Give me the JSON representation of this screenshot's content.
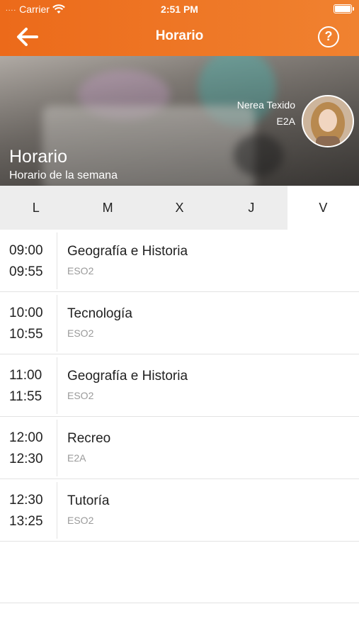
{
  "status_bar": {
    "signal": "....",
    "carrier": "Carrier",
    "time": "2:51 PM"
  },
  "nav": {
    "title": "Horario",
    "back_icon": "arrow-left-icon",
    "help_icon": "question-circle-icon",
    "help_glyph": "?"
  },
  "hero": {
    "title": "Horario",
    "subtitle": "Horario de la semana",
    "user_name": "Nerea Texido",
    "user_group": "E2A"
  },
  "days": {
    "items": [
      "L",
      "M",
      "X",
      "J",
      "V"
    ],
    "selected": "V"
  },
  "schedule": [
    {
      "start": "09:00",
      "end": "09:55",
      "subject": "Geografía e Historia",
      "group": "ESO2"
    },
    {
      "start": "10:00",
      "end": "10:55",
      "subject": "Tecnología",
      "group": "ESO2"
    },
    {
      "start": "11:00",
      "end": "11:55",
      "subject": "Geografía e Historia",
      "group": "ESO2"
    },
    {
      "start": "12:00",
      "end": "12:30",
      "subject": "Recreo",
      "group": "E2A"
    },
    {
      "start": "12:30",
      "end": "13:25",
      "subject": "Tutoría",
      "group": "ESO2"
    }
  ],
  "colors": {
    "accent": "#ec6a1a",
    "tab_bg": "#ededed",
    "muted_text": "#9a9a9a"
  }
}
